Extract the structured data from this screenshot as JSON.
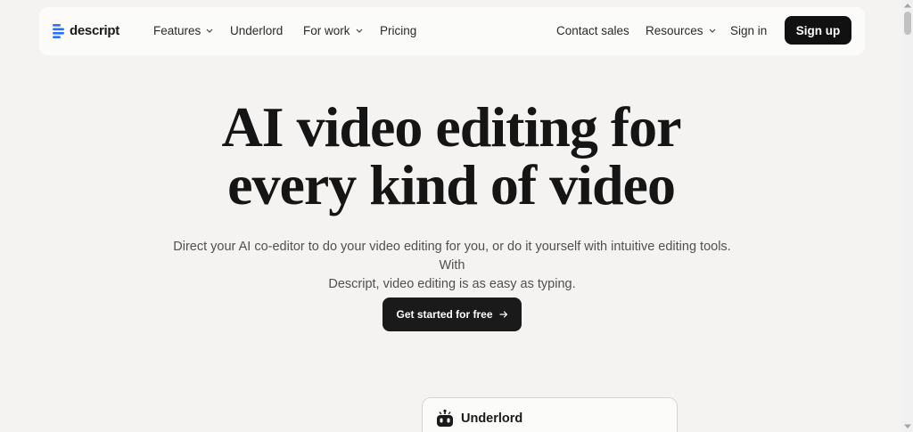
{
  "nav": {
    "logo_text": "descript",
    "items": [
      {
        "label": "Features",
        "has_dropdown": true
      },
      {
        "label": "Underlord",
        "has_dropdown": false
      },
      {
        "label": "For work",
        "has_dropdown": true
      },
      {
        "label": "Pricing",
        "has_dropdown": false
      }
    ],
    "right_items": [
      {
        "label": "Contact sales",
        "has_dropdown": false
      },
      {
        "label": "Resources",
        "has_dropdown": true
      },
      {
        "label": "Sign in",
        "has_dropdown": false
      }
    ],
    "signup_label": "Sign up"
  },
  "hero": {
    "title_line1": "AI video editing for",
    "title_line2": "every kind of video",
    "subtitle_line1": "Direct your AI co-editor to do your video editing for you, or do it yourself with intuitive editing tools. With",
    "subtitle_line2": "Descript, video editing is as easy as typing.",
    "cta_label": "Get started for free",
    "cta_icon": "arrow-right-icon"
  },
  "card": {
    "title": "Underlord",
    "icon": "robot-icon"
  },
  "colors": {
    "page_bg": "#f4f3f1",
    "nav_bg": "#fbfbfa",
    "button_bg": "#111111",
    "logo_blue": "#2b6fff"
  }
}
